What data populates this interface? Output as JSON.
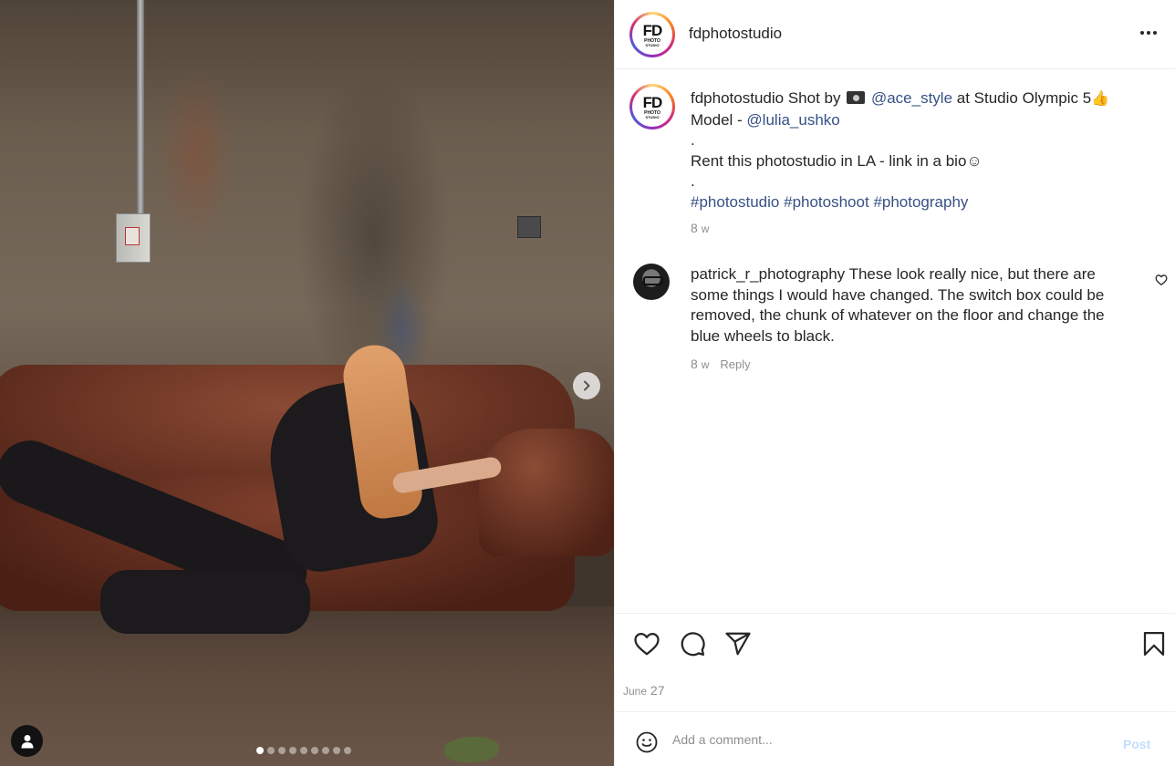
{
  "photo": {
    "alt": "",
    "carousel_count": 9,
    "carousel_active": 0
  },
  "header": {
    "avatar_logo_main": "FD",
    "avatar_logo_sub1": "PHOTO",
    "avatar_logo_sub2": "STUDIO",
    "username": "fdphotostudio"
  },
  "caption": {
    "username": "fdphotostudio",
    "line1_pre": "Shot by",
    "mention1": "@ace_style",
    "line1_post": "at Studio Olympic 5",
    "line2_pre": "Model -",
    "mention2": "@lulia_ushko",
    "dot1": ".",
    "line3": "Rent this photostudio in LA - link in a bio",
    "smile": "☺",
    "dot2": ".",
    "hashtag1": "#photostudio",
    "hashtag2": "#photoshoot",
    "hashtag3": "#photography",
    "time_value": "8",
    "time_unit": "w"
  },
  "comment": {
    "username": "patrick_r_photography",
    "text": "These look really nice, but there are some things I would have changed. The switch box could be removed, the chunk of whatever on the floor and change the blue wheels to black.",
    "time_value": "8",
    "time_unit": "w",
    "reply_label": "Reply"
  },
  "actions": {
    "icons": [
      "heart-icon",
      "comment-icon",
      "share-icon",
      "bookmark-icon"
    ]
  },
  "date": {
    "month": "June",
    "day": "27"
  },
  "add_comment": {
    "placeholder": "Add a comment...",
    "post_label": "Post"
  },
  "colors": {
    "link": "#385185",
    "muted": "#8e8e8e",
    "post_disabled": "#c0dffd"
  }
}
